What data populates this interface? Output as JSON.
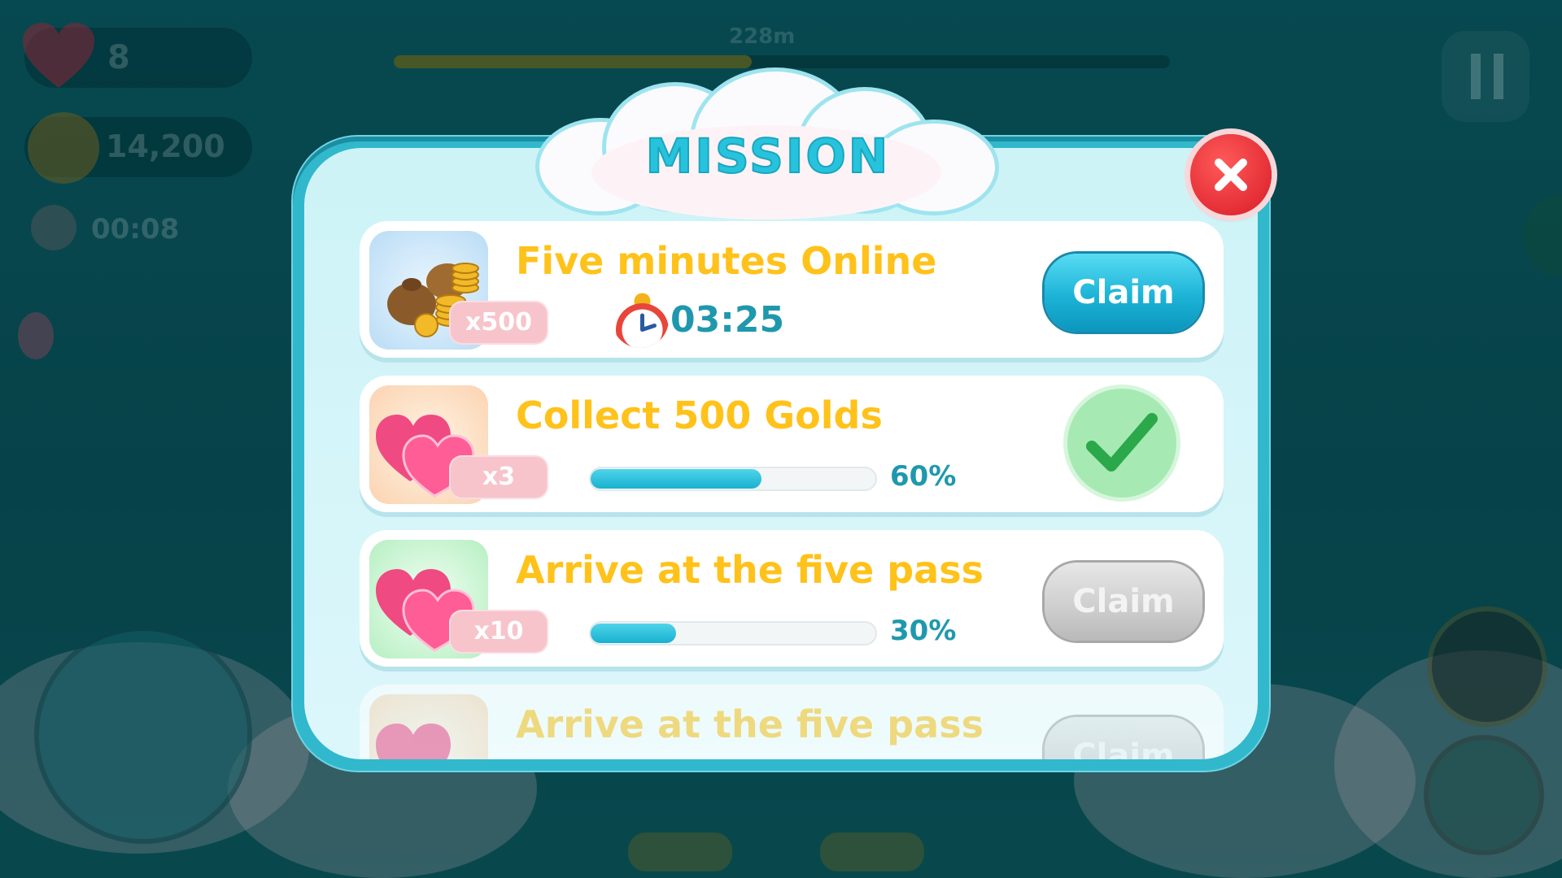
{
  "hud": {
    "lives": "8",
    "coins": "14,200",
    "elapsed": "00:08",
    "distance": "228m"
  },
  "modal": {
    "title": "MISSION",
    "close_icon": "close-x-icon"
  },
  "missions": [
    {
      "title": "Five minutes Online",
      "reward_icon": "gold-coin-bags-icon",
      "reward_count": "x500",
      "timer": "03:25",
      "timer_icon": "alarm-clock-icon",
      "action": "Claim",
      "state": "claimable"
    },
    {
      "title": "Collect 500 Golds",
      "reward_icon": "pink-hearts-icon",
      "reward_count": "x3",
      "progress": 0.6,
      "progress_label": "60%",
      "state": "completed",
      "status_icon": "checkmark-icon"
    },
    {
      "title": "Arrive at the five pass",
      "reward_icon": "pink-hearts-icon",
      "reward_count": "x10",
      "progress": 0.3,
      "progress_label": "30%",
      "action": "Claim",
      "state": "locked"
    },
    {
      "title": "Arrive at the five pass",
      "reward_icon": "pink-hearts-icon",
      "action": "Claim",
      "state": "locked"
    }
  ],
  "colors": {
    "accent": "#27c3dc",
    "title_text": "#ffc21a",
    "progress": "#1cb3d3",
    "close": "#e0262e",
    "check": "#2aa84a"
  }
}
